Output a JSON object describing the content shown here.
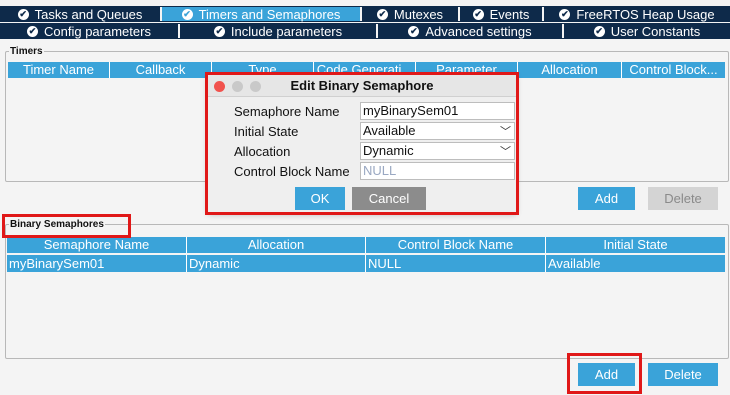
{
  "tabs_row1": [
    {
      "label": "Tasks and Queues",
      "active": false
    },
    {
      "label": "Timers and Semaphores",
      "active": true
    },
    {
      "label": "Mutexes",
      "active": false
    },
    {
      "label": "Events",
      "active": false
    },
    {
      "label": "FreeRTOS Heap Usage",
      "active": false
    }
  ],
  "tabs_row2": [
    {
      "label": "Config parameters"
    },
    {
      "label": "Include parameters"
    },
    {
      "label": "Advanced settings"
    },
    {
      "label": "User Constants"
    }
  ],
  "timers": {
    "legend": "Timers",
    "columns": [
      "Timer Name",
      "Callback",
      "Type",
      "Code Generati...",
      "Parameter",
      "Allocation",
      "Control Block..."
    ],
    "add_label": "Add",
    "delete_label": "Delete"
  },
  "binary_semaphores": {
    "legend": "Binary Semaphores",
    "columns": [
      "Semaphore Name",
      "Allocation",
      "Control Block Name",
      "Initial State"
    ],
    "rows": [
      [
        "myBinarySem01",
        "Dynamic",
        "NULL",
        "Available"
      ]
    ],
    "add_label": "Add",
    "delete_label": "Delete"
  },
  "dialog": {
    "title": "Edit Binary Semaphore",
    "fields": [
      {
        "label": "Semaphore Name",
        "value": "myBinarySem01"
      },
      {
        "label": "Initial State",
        "value": "Available"
      },
      {
        "label": "Allocation",
        "value": "Dynamic"
      },
      {
        "label": "Control Block Name",
        "placeholder": "NULL"
      }
    ],
    "ok_label": "OK",
    "cancel_label": "Cancel"
  },
  "colors": {
    "accent": "#3aa3d9",
    "tab_bg": "#0e2a4a",
    "highlight": "#e01818"
  }
}
